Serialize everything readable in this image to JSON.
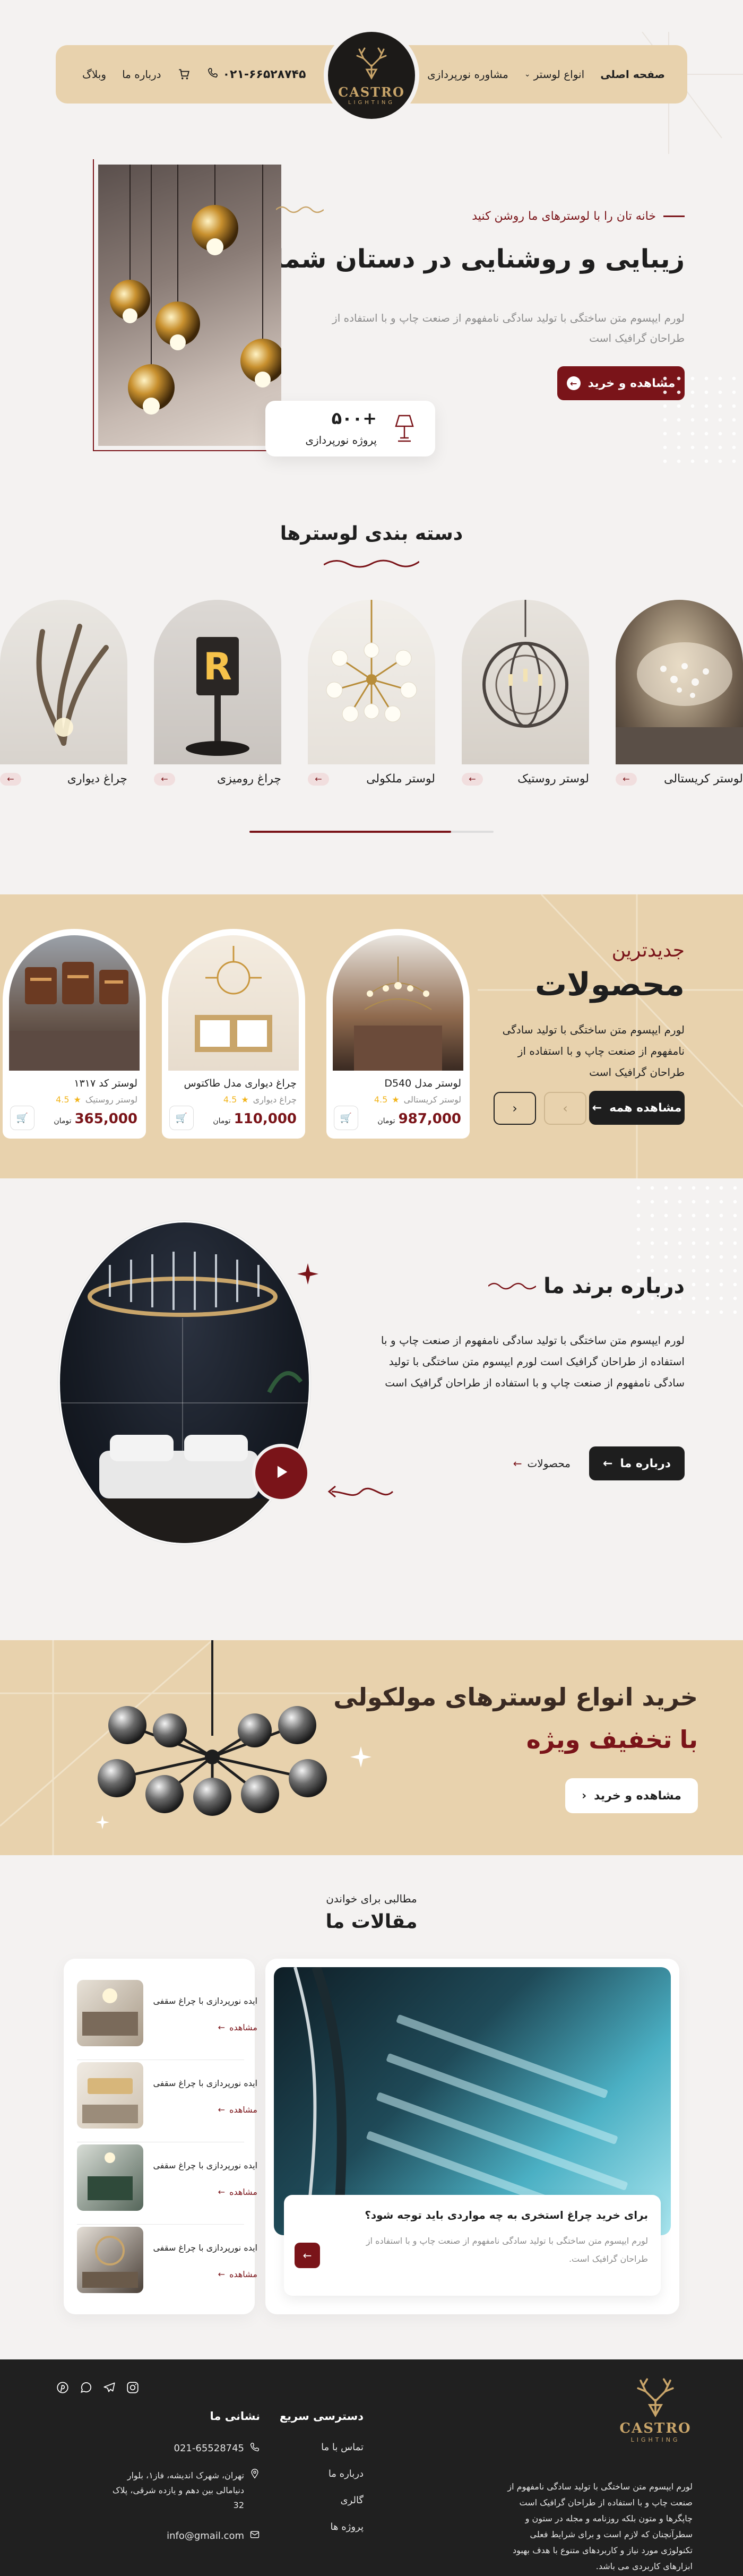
{
  "header": {
    "nav": [
      {
        "label": "صفحه اصلی",
        "active": true
      },
      {
        "label": "انواع لوستر",
        "has_dropdown": true
      },
      {
        "label": "مشاوره نورپردازی"
      },
      {
        "label": "وبلاگ"
      },
      {
        "label": "درباره ما"
      }
    ],
    "phone": "۰۲۱-۶۶۵۲۸۷۴۵",
    "logo_name": "CASTRO",
    "logo_sub": "LIGHTING"
  },
  "hero": {
    "eyebrow": "خانه تان را با لوسترهای ما روشن کنید",
    "title": "زیبایی و روشنایی در دستان شما",
    "desc": "لورم ایپسوم متن ساختگی با تولید سادگی نامفهوم از صنعت چاپ و با استفاده از طراحان گرافیک است",
    "cta": "مشاهده و خرید",
    "stat_value": "+۵۰۰",
    "stat_label": "پروژه نورپردازی"
  },
  "categories": {
    "title": "دسته بندی لوسترها",
    "items": [
      {
        "label": "لوستر کریستالی"
      },
      {
        "label": "لوستر روستیک"
      },
      {
        "label": "لوستر ملکولی"
      },
      {
        "label": "چراغ رومیزی"
      },
      {
        "label": "چراغ دیواری"
      }
    ]
  },
  "products": {
    "eyebrow": "جدیدترین",
    "title": "محصولات",
    "desc": "لورم ایپسوم متن ساختگی با تولید سادگی نامفهوم از صنعت چاپ و با استفاده از طراحان گرافیک است",
    "cta": "مشاهده همه",
    "currency": "تومان",
    "items": [
      {
        "name": "لوستر مدل D540",
        "category": "لوستر کریستالی",
        "rating": "4.5",
        "price": "987,000"
      },
      {
        "name": "چراغ دیواری مدل طاکتوس",
        "category": "چراغ دیواری",
        "rating": "4.5",
        "price": "110,000"
      },
      {
        "name": "لوستر کد ۱۳۱۷",
        "category": "لوستر روستیک",
        "rating": "4.5",
        "price": "365,000"
      }
    ]
  },
  "about": {
    "title": "درباره برند ما",
    "desc": "لورم ایپسوم متن ساختگی با تولید سادگی نامفهوم از صنعت چاپ و با استفاده از طراحان گرافیک است لورم ایپسوم متن ساختگی با تولید سادگی نامفهوم از صنعت چاپ و با استفاده از طراحان گرافیک است",
    "cta_primary": "درباره ما",
    "cta_secondary": "محصولات"
  },
  "promo": {
    "title": "خرید انواع لوسترهای مولکولی",
    "subtitle_prefix": "با",
    "subtitle_highlight": "تخفیف ویژه",
    "cta": "مشاهده و خرید"
  },
  "articles": {
    "eyebrow": "مطالبی برای خواندن",
    "title": "مقالات ما",
    "featured": {
      "title": "برای خرید چراغ استخری به چه مواردی باید توجه شود؟",
      "excerpt": "لورم ایپسوم متن ساختگی با تولید سادگی نامفهوم از صنعت چاپ و با استفاده از طراحان گرافیک است."
    },
    "items": [
      {
        "title": "ایده نورپردازی با چراغ سقفی",
        "link": "مشاهده"
      },
      {
        "title": "ایده نورپردازی با چراغ سقفی",
        "link": "مشاهده"
      },
      {
        "title": "ایده نورپردازی با چراغ سقفی",
        "link": "مشاهده"
      },
      {
        "title": "ایده نورپردازی با چراغ سقفی",
        "link": "مشاهده"
      }
    ]
  },
  "footer": {
    "logo_name": "CASTRO",
    "logo_sub": "LIGHTING",
    "about_text": "لورم ایپسوم متن ساختگی با تولید سادگی نامفهوم از صنعت چاپ و با استفاده از طراحان گرافیک است چاپگرها و متون بلکه روزنامه و مجله در ستون و سطرآنچنان که لازم است و برای شرایط فعلی تکنولوژی مورد نیاز و کاربردهای متنوع با هدف بهبود ابزارهای کاربردی می باشد.",
    "quick_title": "دسترسی سریع",
    "quick_links": [
      "تماس با ما",
      "درباره ما",
      "گالری",
      "پروژه ها"
    ],
    "contact_title": "نشانی ما",
    "phone": "021-65528745",
    "address": "تهران، شهرک اندیشه، فاز۱، بلوار دنیامالی بین دهم و یازده شرقی، پلاک 32",
    "email": "info@gmail.com"
  },
  "colors": {
    "burgundy": "#7a1419",
    "beige": "#e8d2ad",
    "dark": "#202020",
    "background": "#f4f2f1"
  }
}
